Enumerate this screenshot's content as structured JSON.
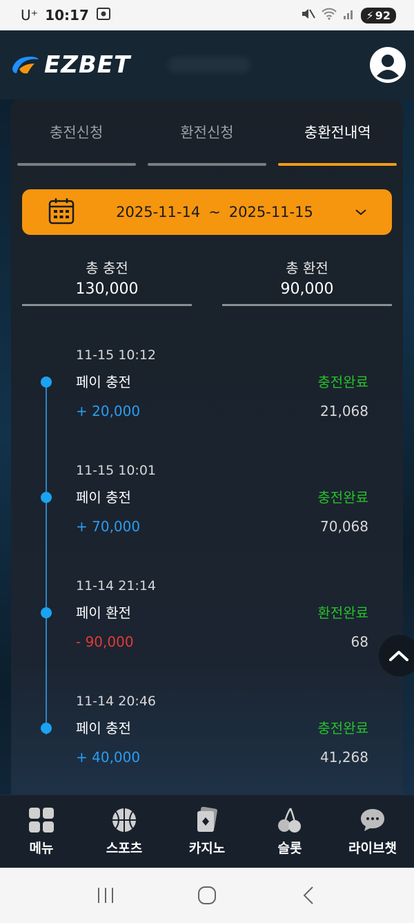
{
  "status_bar": {
    "carrier": "U⁺",
    "time": "10:17",
    "battery": "92"
  },
  "header": {
    "logo_text": "EZBET"
  },
  "tabs": [
    {
      "label": "충전신청",
      "active": false
    },
    {
      "label": "환전신청",
      "active": false
    },
    {
      "label": "충환전내역",
      "active": true
    }
  ],
  "date_picker": {
    "start": "2025-11-14",
    "separator": "~",
    "end": "2025-11-15"
  },
  "totals": {
    "charge_label": "총 충전",
    "charge_value": "130,000",
    "exchange_label": "총 환전",
    "exchange_value": "90,000"
  },
  "history": [
    {
      "time": "11-15 10:12",
      "type": "페이 충전",
      "status": "충전완료",
      "amount": "+ 20,000",
      "balance": "21,068",
      "direction": "plus"
    },
    {
      "time": "11-15 10:01",
      "type": "페이 충전",
      "status": "충전완료",
      "amount": "+ 70,000",
      "balance": "70,068",
      "direction": "plus"
    },
    {
      "time": "11-14 21:14",
      "type": "페이 환전",
      "status": "환전완료",
      "amount": "- 90,000",
      "balance": "68",
      "direction": "minus"
    },
    {
      "time": "11-14 20:46",
      "type": "페이 충전",
      "status": "충전완료",
      "amount": "+ 40,000",
      "balance": "41,268",
      "direction": "plus"
    }
  ],
  "bottom_nav": [
    {
      "label": "메뉴",
      "icon": "grid-icon"
    },
    {
      "label": "스포츠",
      "icon": "basketball-icon"
    },
    {
      "label": "카지노",
      "icon": "cards-icon"
    },
    {
      "label": "슬롯",
      "icon": "cherry-icon"
    },
    {
      "label": "라이브챗",
      "icon": "chat-icon"
    }
  ],
  "colors": {
    "accent": "#f6960f",
    "plus": "#2b9cf2",
    "minus": "#e13a3a",
    "status_done": "#25c12a"
  }
}
